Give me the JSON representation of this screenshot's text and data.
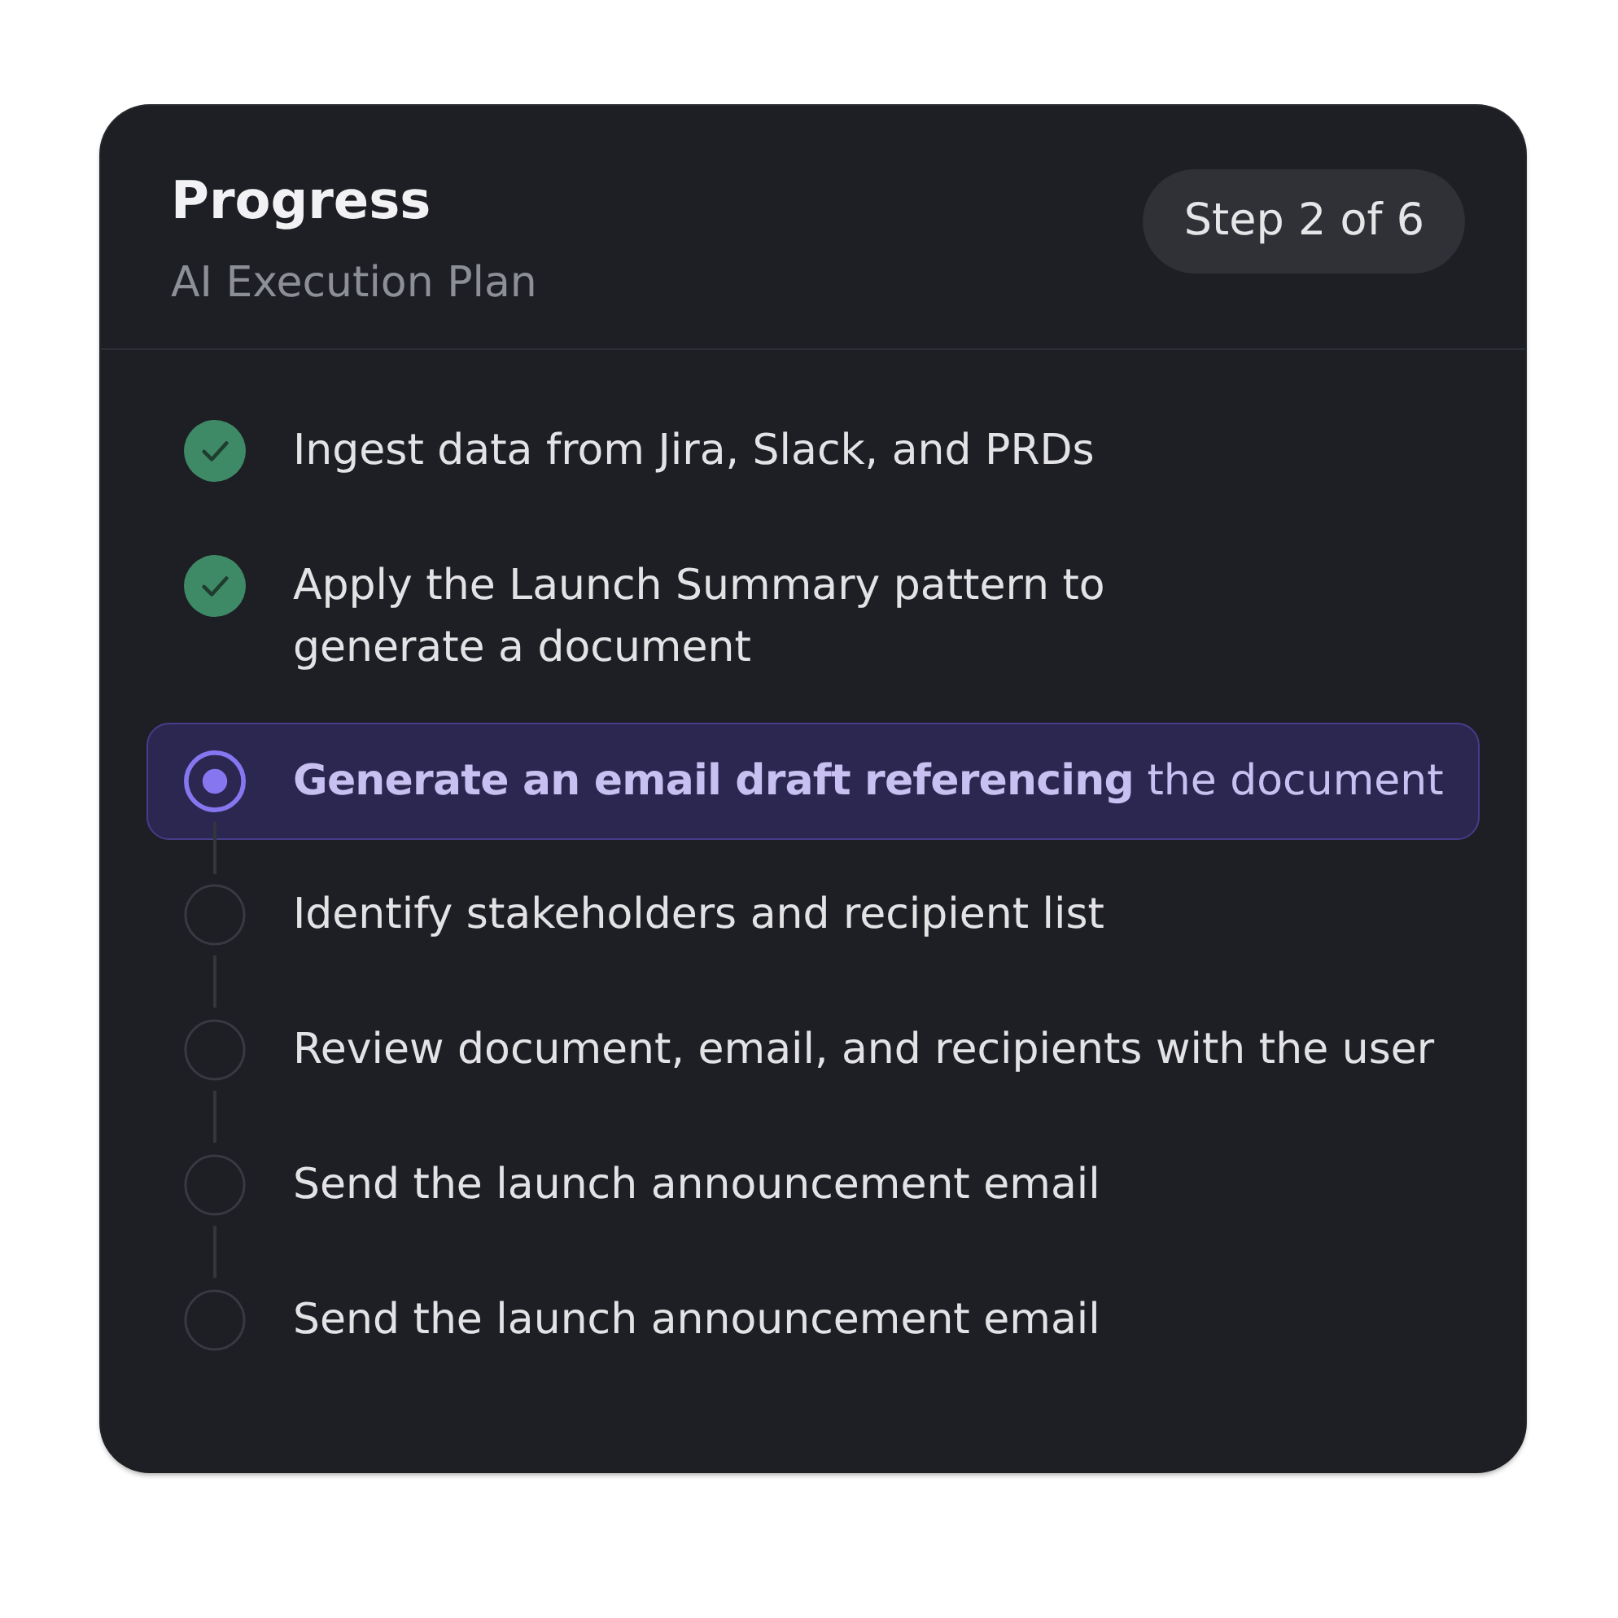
{
  "header": {
    "title": "Progress",
    "subtitle": "AI Execution Plan",
    "step_badge": "Step 2 of 6"
  },
  "steps": [
    {
      "label": "Ingest data from Jira, Slack, and PRDs",
      "done": true,
      "current": false
    },
    {
      "label": "Apply the Launch Summary pattern to\ngenerate a document",
      "done": true,
      "current": false
    },
    {
      "label": "**Generate an email draft referencing** the document",
      "done": false,
      "current": true
    },
    {
      "label": "Identify stakeholders and recipient list",
      "done": false,
      "current": false
    },
    {
      "label": "Review document, email, and recipients with the user",
      "done": false,
      "current": false
    },
    {
      "label": "Send the launch announcement email",
      "done": false,
      "current": false
    },
    {
      "label": "Send the launch announcement email",
      "done": false,
      "current": false
    }
  ]
}
